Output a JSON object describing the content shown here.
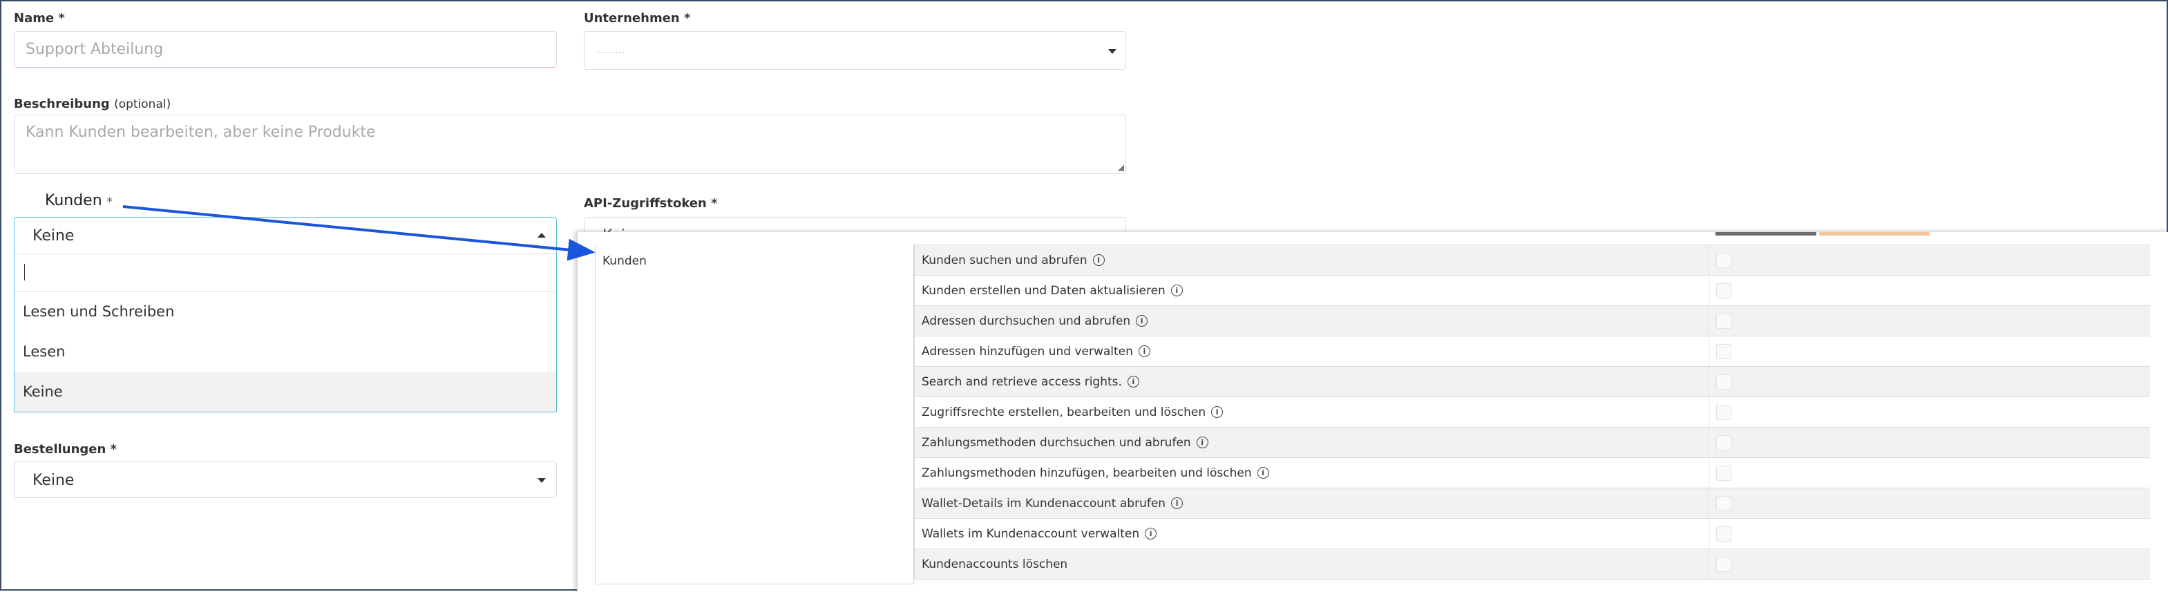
{
  "form": {
    "name": {
      "label": "Name",
      "required": "*",
      "placeholder": "Support Abteilung"
    },
    "company": {
      "label": "Unternehmen",
      "required": "*",
      "value": "........"
    },
    "description": {
      "label": "Beschreibung",
      "optional": "(optional)",
      "placeholder": "Kann Kunden bearbeiten, aber keine Produkte"
    },
    "customers": {
      "label": "Kunden",
      "required": "*",
      "value": "Keine",
      "search_value": "",
      "options": [
        "Lesen und Schreiben",
        "Lesen",
        "Keine"
      ]
    },
    "api_token": {
      "label": "API-Zugriffstoken",
      "required": "*",
      "value": "Keine"
    },
    "orders": {
      "label": "Bestellungen",
      "required": "*",
      "value": "Keine"
    }
  },
  "permissions": {
    "category": "Kunden",
    "rows": [
      {
        "label": "Kunden suchen und abrufen",
        "info": true
      },
      {
        "label": "Kunden erstellen und Daten aktualisieren",
        "info": true
      },
      {
        "label": "Adressen durchsuchen und abrufen",
        "info": true
      },
      {
        "label": "Adressen hinzufügen und verwalten",
        "info": true
      },
      {
        "label": "Search and retrieve access rights.",
        "info": true
      },
      {
        "label": "Zugriffsrechte erstellen, bearbeiten und löschen",
        "info": true
      },
      {
        "label": "Zahlungsmethoden durchsuchen und abrufen",
        "info": true
      },
      {
        "label": "Zahlungsmethoden hinzufügen, bearbeiten und löschen",
        "info": true
      },
      {
        "label": "Wallet-Details im Kundenaccount abrufen",
        "info": true
      },
      {
        "label": "Wallets im Kundenaccount verwalten",
        "info": true
      },
      {
        "label": "Kundenaccounts löschen",
        "info": false
      }
    ]
  },
  "colors": {
    "accent": "#5bc0de",
    "arrow": "#1a56db",
    "tab_gray": "#6c6c6c",
    "tab_orange": "#f5c49a"
  }
}
